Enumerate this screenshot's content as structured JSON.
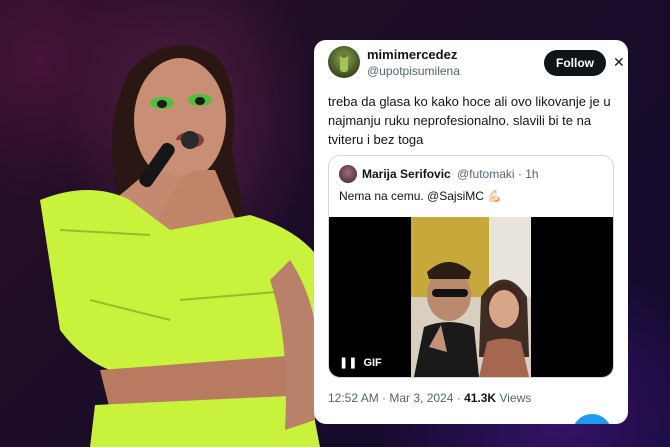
{
  "tweet": {
    "username": "mimimercedez",
    "handle": "@upotpisumilena",
    "follow_label": "Follow",
    "close_glyph": "✕",
    "text": "treba da glasa ko kako hoce ali ovo likovanje je u najmanju ruku neprofesionalno. slavili bi te na tviteru i bez toga",
    "quote": {
      "name": "Marija Serifovic",
      "handle_time": "@futomaki · 1h",
      "text": "Nema na cemu. @SajsiMC 💪🏻",
      "gif_label": "GIF"
    },
    "timestamp": "12:52 AM · Mar 3, 2024 ·",
    "views_count": "41.3K",
    "views_label": "Views"
  },
  "colors": {
    "accent": "#1d9bf0",
    "text": "#0f1419",
    "muted": "#536471",
    "outfit": "#c8f23c"
  }
}
